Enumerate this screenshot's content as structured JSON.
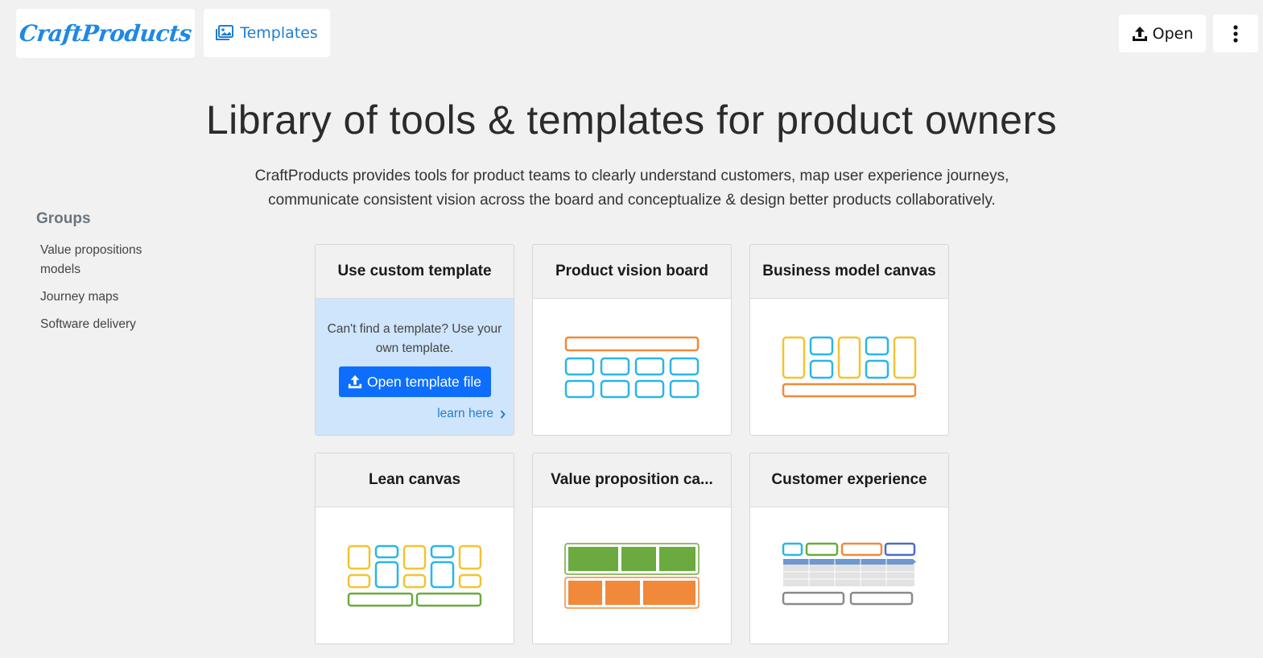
{
  "header": {
    "logo": "CraftProducts",
    "templates_label": "Templates",
    "open_label": "Open"
  },
  "hero": {
    "title": "Library of tools & templates for product owners",
    "description_line1": "CraftProducts provides tools for product teams to clearly understand customers, map user experience journeys,",
    "description_line2": "communicate consistent vision across the board and conceptualize & design better products collaboratively."
  },
  "sidebar": {
    "title": "Groups",
    "items": [
      {
        "label_line1": "Value propositions",
        "label_line2": "models"
      },
      {
        "label_line1": "Journey maps"
      },
      {
        "label_line1": "Software delivery"
      }
    ]
  },
  "cards": {
    "custom": {
      "title": "Use custom template",
      "text": "Can't find a template? Use your own template.",
      "button": "Open template file",
      "link": "learn here"
    },
    "templates": [
      {
        "title": "Product vision board"
      },
      {
        "title": "Business model canvas"
      },
      {
        "title": "Lean canvas"
      },
      {
        "title": "Value proposition ca..."
      },
      {
        "title": "Customer experience"
      }
    ]
  },
  "colors": {
    "brand_blue": "#1e88e5",
    "primary_button": "#0d6efd",
    "link": "#1f7fd1",
    "custom_card_bg": "#cfe5fb",
    "orange": "#f0893a",
    "cyan": "#29b6e8",
    "yellow": "#f5c330",
    "green": "#6aaa3e",
    "navy": "#4a6cc7"
  }
}
